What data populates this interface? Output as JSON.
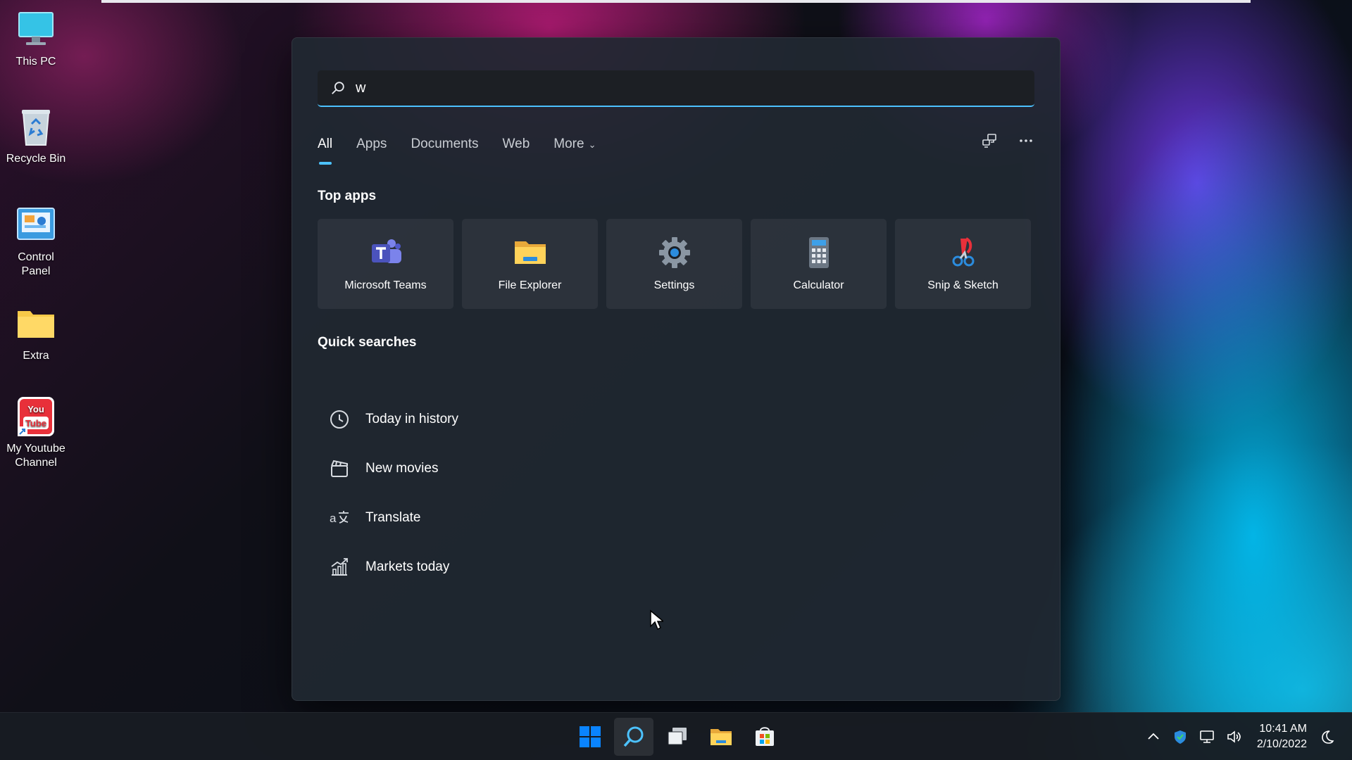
{
  "desktop": {
    "icons": [
      {
        "label": "This PC",
        "icon": "monitor-icon"
      },
      {
        "label": "Recycle Bin",
        "icon": "recycle-bin-icon"
      },
      {
        "label": "Control Panel",
        "icon": "control-panel-icon"
      },
      {
        "label": "Extra",
        "icon": "folder-icon"
      },
      {
        "label": "My Youtube Channel",
        "icon": "youtube-shortcut-icon"
      }
    ],
    "youtube_icon_text": [
      "You",
      "Tube"
    ]
  },
  "search": {
    "query": "w",
    "tabs": [
      {
        "label": "All",
        "active": true
      },
      {
        "label": "Apps"
      },
      {
        "label": "Documents"
      },
      {
        "label": "Web"
      },
      {
        "label": "More",
        "has_dropdown": true
      }
    ],
    "tools": [
      "share-device-icon",
      "more-options-icon"
    ],
    "top_apps_title": "Top apps",
    "top_apps": [
      {
        "label": "Microsoft Teams",
        "icon": "teams-icon"
      },
      {
        "label": "File Explorer",
        "icon": "file-explorer-icon"
      },
      {
        "label": "Settings",
        "icon": "settings-gear-icon"
      },
      {
        "label": "Calculator",
        "icon": "calculator-icon"
      },
      {
        "label": "Snip & Sketch",
        "icon": "snip-sketch-icon"
      }
    ],
    "quick_searches_title": "Quick searches",
    "quick_searches": [
      {
        "label": "Today in history",
        "icon": "clock-icon"
      },
      {
        "label": "New movies",
        "icon": "clapperboard-icon"
      },
      {
        "label": "Translate",
        "icon": "translate-icon"
      },
      {
        "label": "Markets today",
        "icon": "chart-icon"
      }
    ]
  },
  "taskbar": {
    "apps": [
      {
        "name": "start-button",
        "icon": "windows-logo-icon"
      },
      {
        "name": "search-button",
        "icon": "search-icon",
        "active": true
      },
      {
        "name": "task-view-button",
        "icon": "task-view-icon"
      },
      {
        "name": "file-explorer-button",
        "icon": "folder-icon"
      },
      {
        "name": "store-button",
        "icon": "store-icon"
      }
    ],
    "tray": [
      "chevron-up-icon",
      "security-shield-icon",
      "network-icon",
      "volume-icon"
    ],
    "time": "10:41 AM",
    "date": "2/10/2022",
    "colors": {
      "accent": "#4cc2ff",
      "windows_blue": "#0a84ff"
    }
  }
}
